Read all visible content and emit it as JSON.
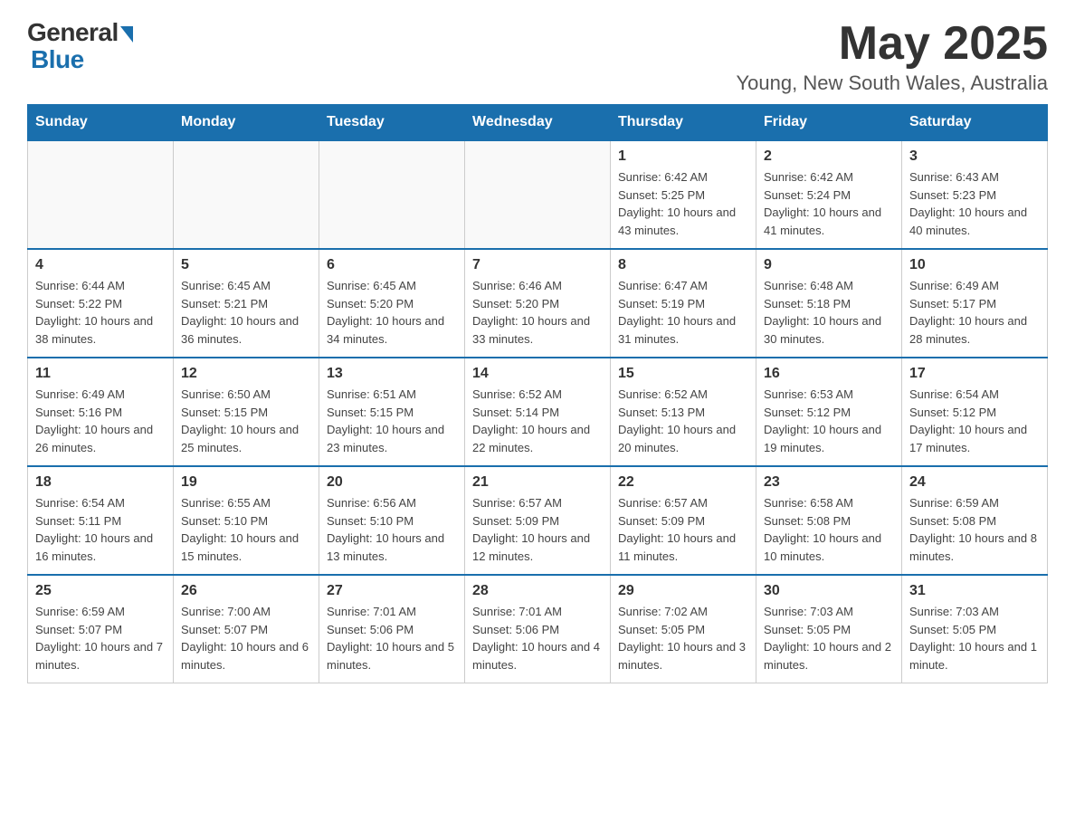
{
  "header": {
    "logo": {
      "general": "General",
      "blue": "Blue"
    },
    "title": "May 2025",
    "location": "Young, New South Wales, Australia"
  },
  "days_of_week": [
    "Sunday",
    "Monday",
    "Tuesday",
    "Wednesday",
    "Thursday",
    "Friday",
    "Saturday"
  ],
  "weeks": [
    [
      {
        "day": "",
        "info": ""
      },
      {
        "day": "",
        "info": ""
      },
      {
        "day": "",
        "info": ""
      },
      {
        "day": "",
        "info": ""
      },
      {
        "day": "1",
        "info": "Sunrise: 6:42 AM\nSunset: 5:25 PM\nDaylight: 10 hours\nand 43 minutes."
      },
      {
        "day": "2",
        "info": "Sunrise: 6:42 AM\nSunset: 5:24 PM\nDaylight: 10 hours\nand 41 minutes."
      },
      {
        "day": "3",
        "info": "Sunrise: 6:43 AM\nSunset: 5:23 PM\nDaylight: 10 hours\nand 40 minutes."
      }
    ],
    [
      {
        "day": "4",
        "info": "Sunrise: 6:44 AM\nSunset: 5:22 PM\nDaylight: 10 hours\nand 38 minutes."
      },
      {
        "day": "5",
        "info": "Sunrise: 6:45 AM\nSunset: 5:21 PM\nDaylight: 10 hours\nand 36 minutes."
      },
      {
        "day": "6",
        "info": "Sunrise: 6:45 AM\nSunset: 5:20 PM\nDaylight: 10 hours\nand 34 minutes."
      },
      {
        "day": "7",
        "info": "Sunrise: 6:46 AM\nSunset: 5:20 PM\nDaylight: 10 hours\nand 33 minutes."
      },
      {
        "day": "8",
        "info": "Sunrise: 6:47 AM\nSunset: 5:19 PM\nDaylight: 10 hours\nand 31 minutes."
      },
      {
        "day": "9",
        "info": "Sunrise: 6:48 AM\nSunset: 5:18 PM\nDaylight: 10 hours\nand 30 minutes."
      },
      {
        "day": "10",
        "info": "Sunrise: 6:49 AM\nSunset: 5:17 PM\nDaylight: 10 hours\nand 28 minutes."
      }
    ],
    [
      {
        "day": "11",
        "info": "Sunrise: 6:49 AM\nSunset: 5:16 PM\nDaylight: 10 hours\nand 26 minutes."
      },
      {
        "day": "12",
        "info": "Sunrise: 6:50 AM\nSunset: 5:15 PM\nDaylight: 10 hours\nand 25 minutes."
      },
      {
        "day": "13",
        "info": "Sunrise: 6:51 AM\nSunset: 5:15 PM\nDaylight: 10 hours\nand 23 minutes."
      },
      {
        "day": "14",
        "info": "Sunrise: 6:52 AM\nSunset: 5:14 PM\nDaylight: 10 hours\nand 22 minutes."
      },
      {
        "day": "15",
        "info": "Sunrise: 6:52 AM\nSunset: 5:13 PM\nDaylight: 10 hours\nand 20 minutes."
      },
      {
        "day": "16",
        "info": "Sunrise: 6:53 AM\nSunset: 5:12 PM\nDaylight: 10 hours\nand 19 minutes."
      },
      {
        "day": "17",
        "info": "Sunrise: 6:54 AM\nSunset: 5:12 PM\nDaylight: 10 hours\nand 17 minutes."
      }
    ],
    [
      {
        "day": "18",
        "info": "Sunrise: 6:54 AM\nSunset: 5:11 PM\nDaylight: 10 hours\nand 16 minutes."
      },
      {
        "day": "19",
        "info": "Sunrise: 6:55 AM\nSunset: 5:10 PM\nDaylight: 10 hours\nand 15 minutes."
      },
      {
        "day": "20",
        "info": "Sunrise: 6:56 AM\nSunset: 5:10 PM\nDaylight: 10 hours\nand 13 minutes."
      },
      {
        "day": "21",
        "info": "Sunrise: 6:57 AM\nSunset: 5:09 PM\nDaylight: 10 hours\nand 12 minutes."
      },
      {
        "day": "22",
        "info": "Sunrise: 6:57 AM\nSunset: 5:09 PM\nDaylight: 10 hours\nand 11 minutes."
      },
      {
        "day": "23",
        "info": "Sunrise: 6:58 AM\nSunset: 5:08 PM\nDaylight: 10 hours\nand 10 minutes."
      },
      {
        "day": "24",
        "info": "Sunrise: 6:59 AM\nSunset: 5:08 PM\nDaylight: 10 hours\nand 8 minutes."
      }
    ],
    [
      {
        "day": "25",
        "info": "Sunrise: 6:59 AM\nSunset: 5:07 PM\nDaylight: 10 hours\nand 7 minutes."
      },
      {
        "day": "26",
        "info": "Sunrise: 7:00 AM\nSunset: 5:07 PM\nDaylight: 10 hours\nand 6 minutes."
      },
      {
        "day": "27",
        "info": "Sunrise: 7:01 AM\nSunset: 5:06 PM\nDaylight: 10 hours\nand 5 minutes."
      },
      {
        "day": "28",
        "info": "Sunrise: 7:01 AM\nSunset: 5:06 PM\nDaylight: 10 hours\nand 4 minutes."
      },
      {
        "day": "29",
        "info": "Sunrise: 7:02 AM\nSunset: 5:05 PM\nDaylight: 10 hours\nand 3 minutes."
      },
      {
        "day": "30",
        "info": "Sunrise: 7:03 AM\nSunset: 5:05 PM\nDaylight: 10 hours\nand 2 minutes."
      },
      {
        "day": "31",
        "info": "Sunrise: 7:03 AM\nSunset: 5:05 PM\nDaylight: 10 hours\nand 1 minute."
      }
    ]
  ]
}
